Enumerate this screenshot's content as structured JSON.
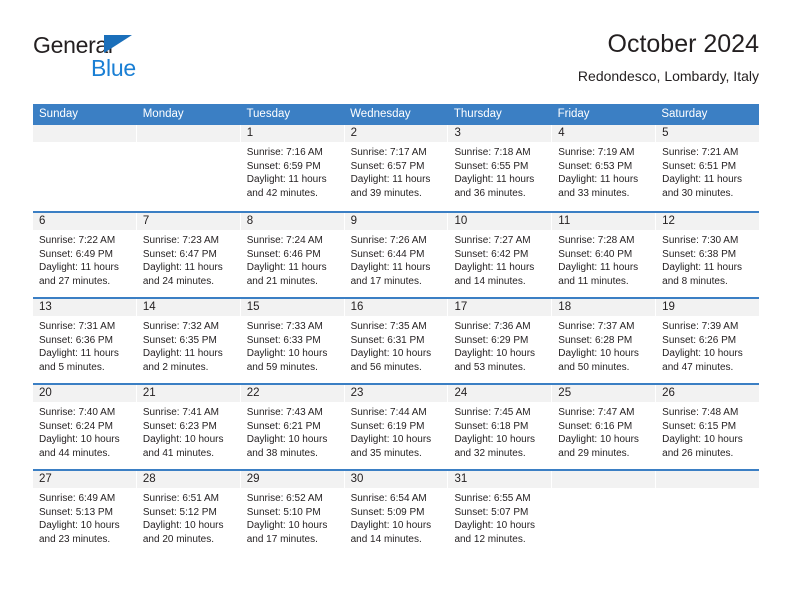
{
  "brand": {
    "name_top": "General",
    "name_bottom": "Blue",
    "triangle_color": "#1a6fba",
    "blue_color": "#1a7fd4"
  },
  "header": {
    "month_title": "October 2024",
    "location": "Redondesco, Lombardy, Italy"
  },
  "theme": {
    "header_blue": "#3b7fc4",
    "date_band_gray": "#f2f2f2"
  },
  "calendar": {
    "weekdays": [
      "Sunday",
      "Monday",
      "Tuesday",
      "Wednesday",
      "Thursday",
      "Friday",
      "Saturday"
    ],
    "weeks": [
      [
        {
          "day": "",
          "sunrise": "",
          "sunset": "",
          "daylight": "",
          "empty": true
        },
        {
          "day": "",
          "sunrise": "",
          "sunset": "",
          "daylight": "",
          "empty": true
        },
        {
          "day": "1",
          "sunrise": "Sunrise: 7:16 AM",
          "sunset": "Sunset: 6:59 PM",
          "daylight": "Daylight: 11 hours and 42 minutes."
        },
        {
          "day": "2",
          "sunrise": "Sunrise: 7:17 AM",
          "sunset": "Sunset: 6:57 PM",
          "daylight": "Daylight: 11 hours and 39 minutes."
        },
        {
          "day": "3",
          "sunrise": "Sunrise: 7:18 AM",
          "sunset": "Sunset: 6:55 PM",
          "daylight": "Daylight: 11 hours and 36 minutes."
        },
        {
          "day": "4",
          "sunrise": "Sunrise: 7:19 AM",
          "sunset": "Sunset: 6:53 PM",
          "daylight": "Daylight: 11 hours and 33 minutes."
        },
        {
          "day": "5",
          "sunrise": "Sunrise: 7:21 AM",
          "sunset": "Sunset: 6:51 PM",
          "daylight": "Daylight: 11 hours and 30 minutes."
        }
      ],
      [
        {
          "day": "6",
          "sunrise": "Sunrise: 7:22 AM",
          "sunset": "Sunset: 6:49 PM",
          "daylight": "Daylight: 11 hours and 27 minutes."
        },
        {
          "day": "7",
          "sunrise": "Sunrise: 7:23 AM",
          "sunset": "Sunset: 6:47 PM",
          "daylight": "Daylight: 11 hours and 24 minutes."
        },
        {
          "day": "8",
          "sunrise": "Sunrise: 7:24 AM",
          "sunset": "Sunset: 6:46 PM",
          "daylight": "Daylight: 11 hours and 21 minutes."
        },
        {
          "day": "9",
          "sunrise": "Sunrise: 7:26 AM",
          "sunset": "Sunset: 6:44 PM",
          "daylight": "Daylight: 11 hours and 17 minutes."
        },
        {
          "day": "10",
          "sunrise": "Sunrise: 7:27 AM",
          "sunset": "Sunset: 6:42 PM",
          "daylight": "Daylight: 11 hours and 14 minutes."
        },
        {
          "day": "11",
          "sunrise": "Sunrise: 7:28 AM",
          "sunset": "Sunset: 6:40 PM",
          "daylight": "Daylight: 11 hours and 11 minutes."
        },
        {
          "day": "12",
          "sunrise": "Sunrise: 7:30 AM",
          "sunset": "Sunset: 6:38 PM",
          "daylight": "Daylight: 11 hours and 8 minutes."
        }
      ],
      [
        {
          "day": "13",
          "sunrise": "Sunrise: 7:31 AM",
          "sunset": "Sunset: 6:36 PM",
          "daylight": "Daylight: 11 hours and 5 minutes."
        },
        {
          "day": "14",
          "sunrise": "Sunrise: 7:32 AM",
          "sunset": "Sunset: 6:35 PM",
          "daylight": "Daylight: 11 hours and 2 minutes."
        },
        {
          "day": "15",
          "sunrise": "Sunrise: 7:33 AM",
          "sunset": "Sunset: 6:33 PM",
          "daylight": "Daylight: 10 hours and 59 minutes."
        },
        {
          "day": "16",
          "sunrise": "Sunrise: 7:35 AM",
          "sunset": "Sunset: 6:31 PM",
          "daylight": "Daylight: 10 hours and 56 minutes."
        },
        {
          "day": "17",
          "sunrise": "Sunrise: 7:36 AM",
          "sunset": "Sunset: 6:29 PM",
          "daylight": "Daylight: 10 hours and 53 minutes."
        },
        {
          "day": "18",
          "sunrise": "Sunrise: 7:37 AM",
          "sunset": "Sunset: 6:28 PM",
          "daylight": "Daylight: 10 hours and 50 minutes."
        },
        {
          "day": "19",
          "sunrise": "Sunrise: 7:39 AM",
          "sunset": "Sunset: 6:26 PM",
          "daylight": "Daylight: 10 hours and 47 minutes."
        }
      ],
      [
        {
          "day": "20",
          "sunrise": "Sunrise: 7:40 AM",
          "sunset": "Sunset: 6:24 PM",
          "daylight": "Daylight: 10 hours and 44 minutes."
        },
        {
          "day": "21",
          "sunrise": "Sunrise: 7:41 AM",
          "sunset": "Sunset: 6:23 PM",
          "daylight": "Daylight: 10 hours and 41 minutes."
        },
        {
          "day": "22",
          "sunrise": "Sunrise: 7:43 AM",
          "sunset": "Sunset: 6:21 PM",
          "daylight": "Daylight: 10 hours and 38 minutes."
        },
        {
          "day": "23",
          "sunrise": "Sunrise: 7:44 AM",
          "sunset": "Sunset: 6:19 PM",
          "daylight": "Daylight: 10 hours and 35 minutes."
        },
        {
          "day": "24",
          "sunrise": "Sunrise: 7:45 AM",
          "sunset": "Sunset: 6:18 PM",
          "daylight": "Daylight: 10 hours and 32 minutes."
        },
        {
          "day": "25",
          "sunrise": "Sunrise: 7:47 AM",
          "sunset": "Sunset: 6:16 PM",
          "daylight": "Daylight: 10 hours and 29 minutes."
        },
        {
          "day": "26",
          "sunrise": "Sunrise: 7:48 AM",
          "sunset": "Sunset: 6:15 PM",
          "daylight": "Daylight: 10 hours and 26 minutes."
        }
      ],
      [
        {
          "day": "27",
          "sunrise": "Sunrise: 6:49 AM",
          "sunset": "Sunset: 5:13 PM",
          "daylight": "Daylight: 10 hours and 23 minutes."
        },
        {
          "day": "28",
          "sunrise": "Sunrise: 6:51 AM",
          "sunset": "Sunset: 5:12 PM",
          "daylight": "Daylight: 10 hours and 20 minutes."
        },
        {
          "day": "29",
          "sunrise": "Sunrise: 6:52 AM",
          "sunset": "Sunset: 5:10 PM",
          "daylight": "Daylight: 10 hours and 17 minutes."
        },
        {
          "day": "30",
          "sunrise": "Sunrise: 6:54 AM",
          "sunset": "Sunset: 5:09 PM",
          "daylight": "Daylight: 10 hours and 14 minutes."
        },
        {
          "day": "31",
          "sunrise": "Sunrise: 6:55 AM",
          "sunset": "Sunset: 5:07 PM",
          "daylight": "Daylight: 10 hours and 12 minutes."
        },
        {
          "day": "",
          "sunrise": "",
          "sunset": "",
          "daylight": "",
          "empty": true
        },
        {
          "day": "",
          "sunrise": "",
          "sunset": "",
          "daylight": "",
          "empty": true
        }
      ]
    ]
  }
}
